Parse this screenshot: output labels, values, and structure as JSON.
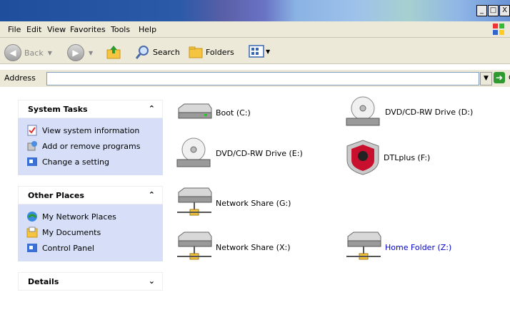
{
  "window": {
    "buttons": [
      "_",
      "□",
      "X"
    ]
  },
  "menu": [
    "File",
    "Edit",
    "View",
    "Favorites",
    "Tools",
    "Help"
  ],
  "toolbar": {
    "back": "Back",
    "search": "Search",
    "folders": "Folders"
  },
  "address": {
    "label": "Address",
    "value": "",
    "go": "Go"
  },
  "tasks": {
    "title": "System Tasks",
    "items": [
      "View system information",
      "Add or remove programs",
      "Change a setting"
    ]
  },
  "places": {
    "title": "Other Places",
    "items": [
      "My Network Places",
      "My Documents",
      "Control Panel"
    ]
  },
  "details": {
    "title": "Details"
  },
  "drives": [
    {
      "label": "Boot (C:)",
      "icon": "hard-drive-icon"
    },
    {
      "label": "DVD/CD-RW Drive (D:)",
      "icon": "dvd-drive-icon"
    },
    {
      "label": "DVD/CD-RW Drive (E:)",
      "icon": "dvd-drive-icon"
    },
    {
      "label": "DTLplus (F:)",
      "icon": "kingston-usb-icon"
    },
    {
      "label": "Network Share (G:)",
      "icon": "network-drive-icon"
    },
    {
      "label": "Network Share (X:)",
      "icon": "network-drive-icon"
    },
    {
      "label": "Home Folder (Z:)",
      "icon": "network-drive-icon"
    }
  ]
}
